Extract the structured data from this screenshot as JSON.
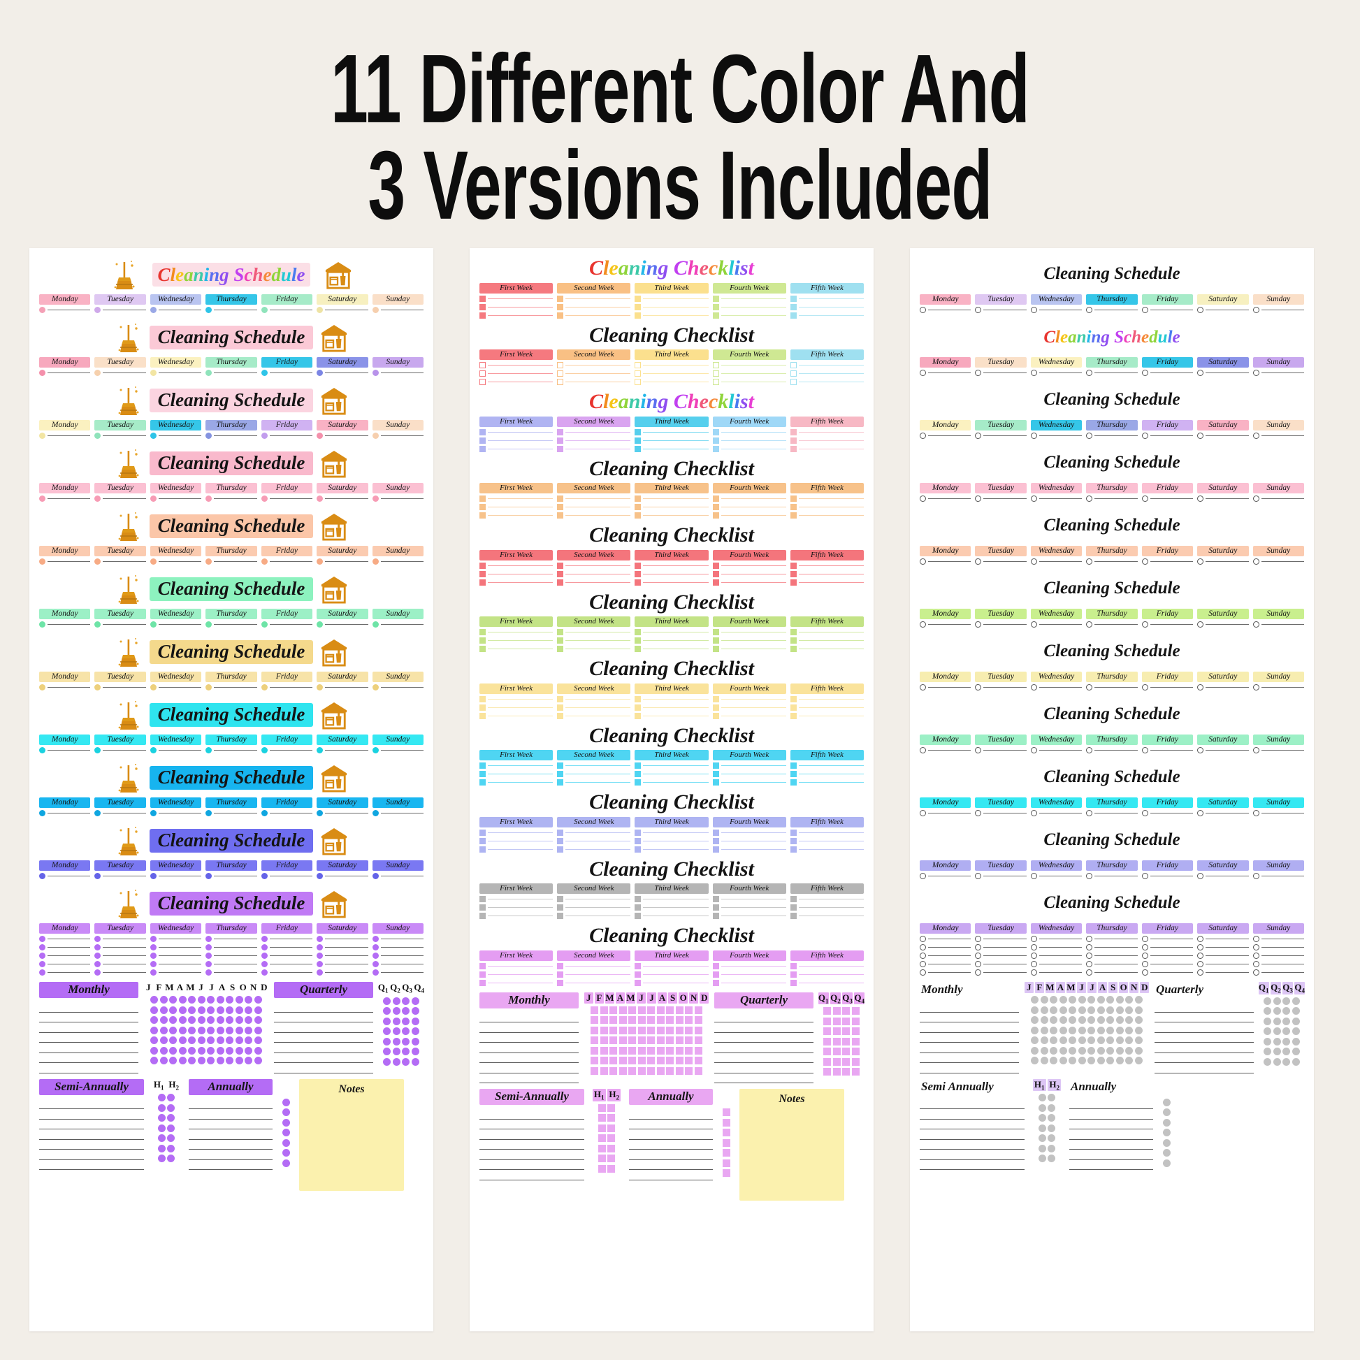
{
  "heading": {
    "line1": "11 Different Color And",
    "line2": "3 Versions Included"
  },
  "background_color": "#f2eee8",
  "card_background": "#ffffff",
  "notes_color": "#fbf1ae",
  "icons": {
    "broom": "broom-icon",
    "house": "house-cleaning-supplies-icon"
  },
  "days": [
    "Monday",
    "Tuesday",
    "Wednesday",
    "Thursday",
    "Friday",
    "Saturday",
    "Sunday"
  ],
  "weeks": [
    "First Week",
    "Second Week",
    "Third Week",
    "Fourth Week",
    "Fifth Week"
  ],
  "months": [
    "J",
    "F",
    "M",
    "A",
    "M",
    "J",
    "J",
    "A",
    "S",
    "O",
    "N",
    "D"
  ],
  "quarters": [
    "Q1",
    "Q2",
    "Q3",
    "Q4"
  ],
  "halves": [
    "H1",
    "H2"
  ],
  "sections": {
    "monthly": "Monthly",
    "quarterly": "Quarterly",
    "semi_annually": "Semi-Annually",
    "semi_annually_plain": "Semi Annually",
    "annually": "Annually",
    "notes": "Notes"
  },
  "card1": {
    "title": "Cleaning Schedule",
    "accent": "#b46cf5",
    "dot_shape": "dot",
    "grid_shape": "round",
    "rows": [
      {
        "title_style": "rainbow",
        "highlight": "#fbdfe6",
        "day_colors": [
          "#f9b2c4",
          "#dfc8f2",
          "#b9c4f0",
          "#35c6e8",
          "#a6ebc8",
          "#f7f0c0",
          "#fadfc8"
        ],
        "dot_colors": [
          "#f4a0b6",
          "#cfa9ea",
          "#9aa8e6",
          "#2ec4e8",
          "#8fe3bb",
          "#eee3a4",
          "#f6cfae"
        ]
      },
      {
        "title_style": "solid",
        "highlight": "#fbc9d6",
        "day_colors": [
          "#f7a8bd",
          "#fae0c8",
          "#fbf1c0",
          "#a6ebc8",
          "#35c6e8",
          "#8a93e8",
          "#c8a8ee"
        ],
        "dot_colors": [
          "#f490ab",
          "#f6d0ad",
          "#f2e5a3",
          "#8fe3bb",
          "#2ec4e8",
          "#7b85e4",
          "#b892ea"
        ]
      },
      {
        "title_style": "solid",
        "highlight": "#fbd4e0",
        "day_colors": [
          "#fbf1c0",
          "#a6ebc8",
          "#35c6e8",
          "#9aa8e6",
          "#d0b2f2",
          "#f9b2c4",
          "#fadfc8"
        ],
        "dot_colors": [
          "#f2e5a3",
          "#8fe3bb",
          "#2ec4e8",
          "#8593e0",
          "#c29ded",
          "#f490ab",
          "#f6cfae"
        ]
      },
      {
        "title_style": "solid",
        "highlight": "#f9b9cc",
        "day_colors": [
          "#fbc0d2",
          "#fbc0d2",
          "#fbc0d2",
          "#fbc0d2",
          "#fbc0d2",
          "#fbc0d2",
          "#fbc0d2"
        ],
        "dot_colors": [
          "#f79cb5",
          "#f79cb5",
          "#f79cb5",
          "#f79cb5",
          "#f79cb5",
          "#f79cb5",
          "#f79cb5"
        ]
      },
      {
        "title_style": "solid",
        "highlight": "#fbc6a8",
        "day_colors": [
          "#fbcbb0",
          "#fbcbb0",
          "#fbcbb0",
          "#fbcbb0",
          "#fbcbb0",
          "#fbcbb0",
          "#fbcbb0"
        ],
        "dot_colors": [
          "#f7ab85",
          "#f7ab85",
          "#f7ab85",
          "#f7ab85",
          "#f7ab85",
          "#f7ab85",
          "#f7ab85"
        ]
      },
      {
        "title_style": "solid",
        "highlight": "#8df2bf",
        "day_colors": [
          "#9cf0c6",
          "#9cf0c6",
          "#9cf0c6",
          "#9cf0c6",
          "#9cf0c6",
          "#9cf0c6",
          "#9cf0c6"
        ],
        "dot_colors": [
          "#6ee4a7",
          "#6ee4a7",
          "#6ee4a7",
          "#6ee4a7",
          "#6ee4a7",
          "#6ee4a7",
          "#6ee4a7"
        ]
      },
      {
        "title_style": "solid",
        "highlight": "#f4d98c",
        "day_colors": [
          "#f7e3a8",
          "#f7e3a8",
          "#f7e3a8",
          "#f7e3a8",
          "#f7e3a8",
          "#f7e3a8",
          "#f7e3a8"
        ],
        "dot_colors": [
          "#edd07c",
          "#edd07c",
          "#edd07c",
          "#edd07c",
          "#edd07c",
          "#edd07c",
          "#edd07c"
        ]
      },
      {
        "title_style": "solid",
        "highlight": "#2fe4ef",
        "day_colors": [
          "#35e8f2",
          "#35e8f2",
          "#35e8f2",
          "#35e8f2",
          "#35e8f2",
          "#35e8f2",
          "#35e8f2"
        ],
        "dot_colors": [
          "#1ad2e0",
          "#1ad2e0",
          "#1ad2e0",
          "#1ad2e0",
          "#1ad2e0",
          "#1ad2e0",
          "#1ad2e0"
        ]
      },
      {
        "title_style": "solid",
        "highlight": "#17b4ef",
        "day_colors": [
          "#19b6f0",
          "#19b6f0",
          "#19b6f0",
          "#19b6f0",
          "#19b6f0",
          "#19b6f0",
          "#19b6f0"
        ],
        "dot_colors": [
          "#0fa6e0",
          "#0fa6e0",
          "#0fa6e0",
          "#0fa6e0",
          "#0fa6e0",
          "#0fa6e0",
          "#0fa6e0"
        ]
      },
      {
        "title_style": "solid",
        "highlight": "#6f6ef0",
        "day_colors": [
          "#7a78f2",
          "#7a78f2",
          "#7a78f2",
          "#7a78f2",
          "#7a78f2",
          "#7a78f2",
          "#7a78f2"
        ],
        "dot_colors": [
          "#6463e8",
          "#6463e8",
          "#6463e8",
          "#6463e8",
          "#6463e8",
          "#6463e8",
          "#6463e8"
        ]
      },
      {
        "title_style": "solid",
        "highlight": "#c07af5",
        "day_colors": [
          "#c98af7",
          "#c98af7",
          "#c98af7",
          "#c98af7",
          "#c98af7",
          "#c98af7",
          "#c98af7"
        ],
        "dot_colors": [
          "#b46cf5",
          "#b46cf5",
          "#b46cf5",
          "#b46cf5",
          "#b46cf5",
          "#b46cf5",
          "#b46cf5"
        ]
      }
    ]
  },
  "card2": {
    "title": "Cleaning Checklist",
    "accent": "#e9a7f2",
    "rows": [
      {
        "title_style": "rainbow",
        "box": "filled",
        "week_colors": [
          "#f5797f",
          "#f9c084",
          "#fbe08e",
          "#cfe893",
          "#9fe0f0"
        ]
      },
      {
        "title_style": "solid",
        "box": "hollow",
        "week_colors": [
          "#f5797f",
          "#f9c084",
          "#fbe08e",
          "#cfe893",
          "#9fe0f0"
        ]
      },
      {
        "title_style": "rainbow",
        "box": "filled",
        "week_colors": [
          "#b0b4f2",
          "#d9a4f0",
          "#56cfed",
          "#9fd8f7",
          "#f7b8c4"
        ]
      },
      {
        "title_style": "solid",
        "box": "filled",
        "week_colors": [
          "#f7c28a",
          "#f7c28a",
          "#f7c28a",
          "#f7c28a",
          "#f7c28a"
        ]
      },
      {
        "title_style": "solid",
        "box": "filled",
        "week_colors": [
          "#f4757c",
          "#f4757c",
          "#f4757c",
          "#f4757c",
          "#f4757c"
        ]
      },
      {
        "title_style": "solid",
        "box": "filled",
        "week_colors": [
          "#c3e386",
          "#c3e386",
          "#c3e386",
          "#c3e386",
          "#c3e386"
        ]
      },
      {
        "title_style": "solid",
        "box": "filled",
        "week_colors": [
          "#fae39b",
          "#fae39b",
          "#fae39b",
          "#fae39b",
          "#fae39b"
        ]
      },
      {
        "title_style": "solid",
        "box": "filled",
        "week_colors": [
          "#4fd5f2",
          "#4fd5f2",
          "#4fd5f2",
          "#4fd5f2",
          "#4fd5f2"
        ]
      },
      {
        "title_style": "solid",
        "box": "filled",
        "week_colors": [
          "#aeb4f2",
          "#aeb4f2",
          "#aeb4f2",
          "#aeb4f2",
          "#aeb4f2"
        ]
      },
      {
        "title_style": "solid",
        "box": "filled",
        "week_colors": [
          "#b5b5b5",
          "#b5b5b5",
          "#b5b5b5",
          "#b5b5b5",
          "#b5b5b5"
        ]
      },
      {
        "title_style": "solid",
        "box": "filled",
        "week_colors": [
          "#e49df2",
          "#e49df2",
          "#e49df2",
          "#e49df2",
          "#e49df2"
        ]
      }
    ]
  },
  "card3": {
    "title": "Cleaning Schedule",
    "accent": "#c2c2c2",
    "grid_shape": "round",
    "rows": [
      {
        "title_style": "plain",
        "day_colors": [
          "#f9b2c4",
          "#dfc8f2",
          "#b9c4f0",
          "#35c6e8",
          "#a6ebc8",
          "#f7f0c0",
          "#fadfc8"
        ]
      },
      {
        "title_style": "rainbow",
        "day_colors": [
          "#f7a8bd",
          "#fae0c8",
          "#fbf1c0",
          "#a6ebc8",
          "#35c6e8",
          "#8a93e8",
          "#c8a8ee"
        ]
      },
      {
        "title_style": "plain",
        "day_colors": [
          "#fbf1c0",
          "#a6ebc8",
          "#35c6e8",
          "#9aa8e6",
          "#d0b2f2",
          "#f9b2c4",
          "#fadfc8"
        ]
      },
      {
        "title_style": "plain",
        "day_colors": [
          "#fbc0d2",
          "#fbc0d2",
          "#fbc0d2",
          "#fbc0d2",
          "#fbc0d2",
          "#fbc0d2",
          "#fbc0d2"
        ]
      },
      {
        "title_style": "plain",
        "day_colors": [
          "#fbcbb0",
          "#fbcbb0",
          "#fbcbb0",
          "#fbcbb0",
          "#fbcbb0",
          "#fbcbb0",
          "#fbcbb0"
        ]
      },
      {
        "title_style": "plain",
        "day_colors": [
          "#c9ef8e",
          "#c9ef8e",
          "#c9ef8e",
          "#c9ef8e",
          "#c9ef8e",
          "#c9ef8e",
          "#c9ef8e"
        ]
      },
      {
        "title_style": "plain",
        "day_colors": [
          "#f7edb0",
          "#f7edb0",
          "#f7edb0",
          "#f7edb0",
          "#f7edb0",
          "#f7edb0",
          "#f7edb0"
        ]
      },
      {
        "title_style": "plain",
        "day_colors": [
          "#9cf0c6",
          "#9cf0c6",
          "#9cf0c6",
          "#9cf0c6",
          "#9cf0c6",
          "#9cf0c6",
          "#9cf0c6"
        ]
      },
      {
        "title_style": "plain",
        "day_colors": [
          "#35e8f2",
          "#35e8f2",
          "#35e8f2",
          "#35e8f2",
          "#35e8f2",
          "#35e8f2",
          "#35e8f2"
        ]
      },
      {
        "title_style": "plain",
        "day_colors": [
          "#b0aef2",
          "#b0aef2",
          "#b0aef2",
          "#b0aef2",
          "#b0aef2",
          "#b0aef2",
          "#b0aef2"
        ]
      },
      {
        "title_style": "plain",
        "day_colors": [
          "#c9a8f2",
          "#c9a8f2",
          "#c9a8f2",
          "#c9a8f2",
          "#c9a8f2",
          "#c9a8f2",
          "#c9a8f2"
        ]
      }
    ]
  },
  "rainbow_palette": [
    "#e8342e",
    "#f28c1e",
    "#f5c518",
    "#8fd43a",
    "#3ec9a8",
    "#22b6e8",
    "#5a6ff0",
    "#8f4ff0",
    "#c13ff0",
    "#ef3fb8",
    "#f05a7a",
    "#f58a3a",
    "#8fd43a",
    "#22c9d4",
    "#4a7bf0",
    "#8f4ff0",
    "#e83fd4"
  ]
}
